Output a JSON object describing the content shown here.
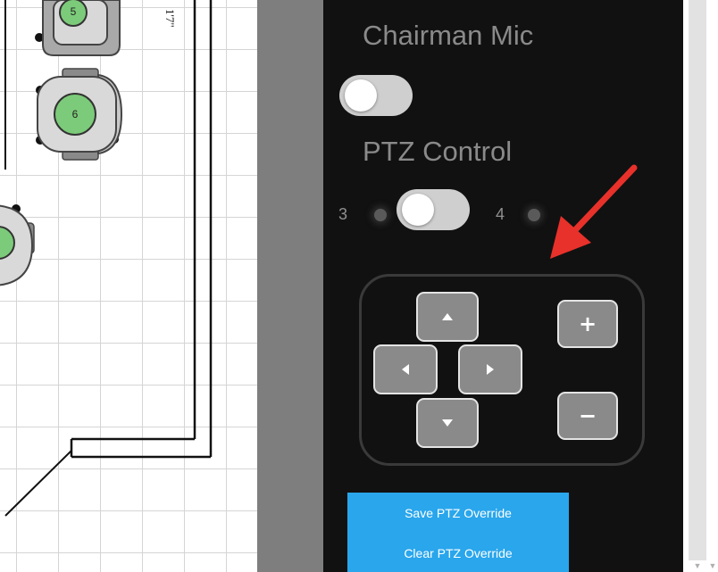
{
  "floor_plan": {
    "seats": [
      {
        "number": "5"
      },
      {
        "number": "6"
      }
    ],
    "dimension_label": "1'7\""
  },
  "panel": {
    "chairman_mic": {
      "title": "Chairman Mic",
      "state": "off"
    },
    "ptz_control": {
      "title": "PTZ Control",
      "left_label": "3",
      "right_label": "4",
      "selected": "3"
    },
    "ptz_pad": {
      "up_icon": "triangle-up-icon",
      "down_icon": "triangle-down-icon",
      "left_icon": "triangle-left-icon",
      "right_icon": "triangle-right-icon",
      "zoom_in_label": "+",
      "zoom_out_label": "−"
    },
    "buttons": {
      "save_label": "Save PTZ Override",
      "clear_label": "Clear PTZ Override"
    }
  },
  "colors": {
    "panel_bg": "#111111",
    "accent_blue": "#29a6ec",
    "annotation_red": "#e8312a",
    "seat_green": "#7ccb7a"
  }
}
